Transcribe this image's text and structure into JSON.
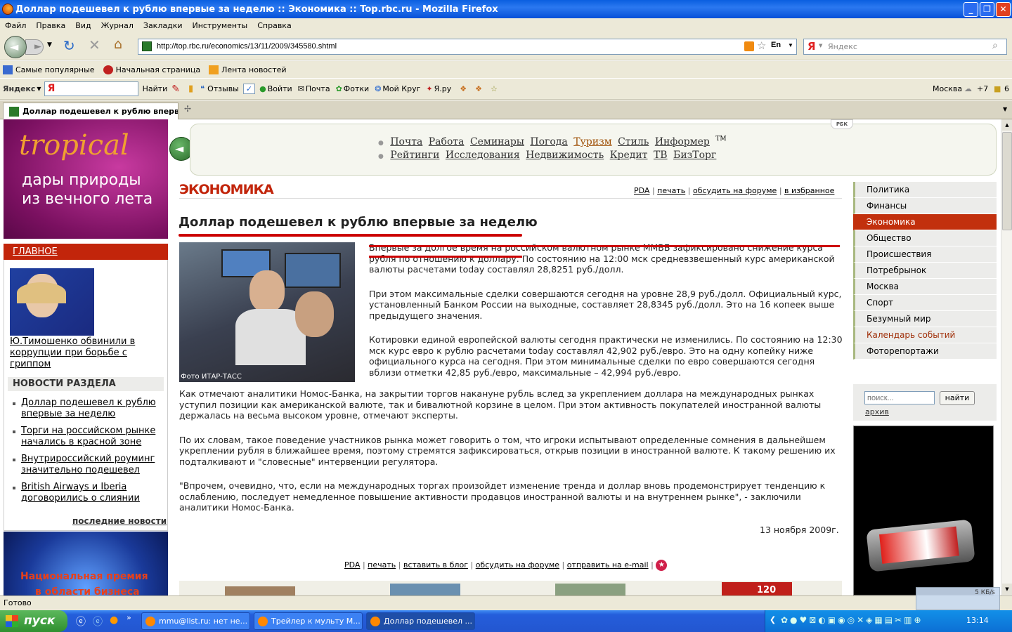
{
  "window": {
    "title": "Доллар подешевел к рублю впервые за неделю :: Экономика :: Top.rbc.ru - Mozilla Firefox"
  },
  "menu": [
    "Файл",
    "Правка",
    "Вид",
    "Журнал",
    "Закладки",
    "Инструменты",
    "Справка"
  ],
  "nav": {
    "url": "http://top.rbc.ru/economics/13/11/2009/345580.shtml",
    "search_placeholder": "Яндекс",
    "lang": "En"
  },
  "bookmarks": [
    "Самые популярные",
    "Начальная страница",
    "Лента новостей"
  ],
  "yandex_bar": {
    "logo": "Яндекс",
    "find": "Найти",
    "items": [
      "Отзывы",
      "Войти",
      "Почта",
      "Фотки",
      "Мой Круг",
      "Я.ру"
    ],
    "city": "Москва",
    "temp": "+7",
    "count": "6"
  },
  "tabs": [
    {
      "label": "Доллар подешевел к рублю вперв..."
    }
  ],
  "page": {
    "ad_top": {
      "brand": "tropical",
      "line1": "дары природы",
      "line2": "из вечного лета"
    },
    "glavnoe": "ГЛАВНОЕ",
    "top_story": "Ю.Тимошенко обвинили в коррупции при борьбе с гриппом",
    "section_news_title": "НОВОСТИ РАЗДЕЛА",
    "section_news": [
      "Доллар подешевел к рублю впервые за неделю",
      "Торги на российском рынке начались в красной зоне",
      "Внутрироссийский роуминг значительно подешевел",
      "British Airways и Iberia договорились о слиянии"
    ],
    "last_news": "последние новости",
    "ad_bottom": {
      "line1": "Национальная премия",
      "line2": "в области бизнеса"
    },
    "rbk": "РБК",
    "topnav_row1": [
      "Почта",
      "Работа",
      "Семинары",
      "Погода",
      "Туризм",
      "Стиль",
      "Информер"
    ],
    "topnav_tm": "TM",
    "topnav_row2": [
      "Рейтинги",
      "Исследования",
      "Недвижимость",
      "Кредит",
      "ТВ",
      "БизТорг"
    ],
    "section": "ЭКОНОМИКА",
    "tools": [
      "PDA",
      "печать",
      "обсудить на форуме",
      "в избранное"
    ],
    "headline": "Доллар подешевел к рублю впервые за неделю",
    "photo_caption": "Фото ИТАР-ТАСС",
    "paragraphs": [
      "Впервые за долгое время на российском валютном рынке ММВБ зафиксировано снижение курса рубля по отношению к доллару. По состоянию на 12:00 мск средневзвешенный курс американской валюты расчетами today составлял 28,8251 руб./долл.",
      "При этом максимальные сделки совершаются сегодня на уровне 28,9 руб./долл. Официальный курс, установленный Банком России на выходные, составляет 28,8345 руб./долл. Это на 16 копеек выше предыдущего значения.",
      "Котировки единой европейской валюты сегодня практически не изменились. По состоянию на 12:30 мск курс евро к рублю расчетами today составлял 42,902 руб./евро. Это на одну копейку ниже официального курса на сегодня. При этом минимальные сделки по евро совершаются сегодня вблизи отметки 42,85 руб./евро, максимальные – 42,994 руб./евро.",
      "Как отмечают аналитики Номос-Банка, на закрытии торгов накануне рубль вслед за укреплением доллара на международных рынках уступил позиции как американской валюте, так и бивалютной корзине в целом. При этом активность покупателей иностранной валюты держалась на весьма высоком уровне, отмечают эксперты.",
      "По их словам, такое поведение участников рынка может говорить о том, что игроки испытывают определенные сомнения в дальнейшем укреплении рубля в ближайшее время, поэтому стремятся зафиксироваться, открыв позиции в иностранной валюте. К такому решению их подталкивают и \"словесные\" интервенции регулятора.",
      "\"Впрочем, очевидно, что, если на международных торгах произойдет изменение тренда и доллар вновь продемонстрирует тенденцию к ослаблению, последует немедленное повышение активности продавцов иностранной валюты и на внутреннем рынке\", - заключили аналитики Номос-Банка."
    ],
    "date": "13 ноября 2009г.",
    "bottom_tools": [
      "PDA",
      "печать",
      "вставить в блог",
      "обсудить на форуме",
      "отправить на e-mail"
    ],
    "rubrics": [
      "Политика",
      "Финансы",
      "Экономика",
      "Общество",
      "Происшествия",
      "Потребрынок",
      "Москва",
      "Спорт",
      "Безумный мир",
      "Календарь событий",
      "Фоторепортажи"
    ],
    "search": {
      "placeholder": "поиск...",
      "button": "найти",
      "archive": "архив"
    },
    "strip_badge": "120"
  },
  "status": {
    "text": "Готово",
    "speed": "5 КБ/s"
  },
  "taskbar": {
    "start": "пуск",
    "tasks": [
      "mmu@list.ru: нет не...",
      "Трейлер к мульту М...",
      "Доллар подешевел ..."
    ],
    "clock": "13:14"
  },
  "colors": {
    "accent_red": "#c2250b",
    "rubric_bg": "#ececea",
    "active_rubric": "#c2300d"
  }
}
